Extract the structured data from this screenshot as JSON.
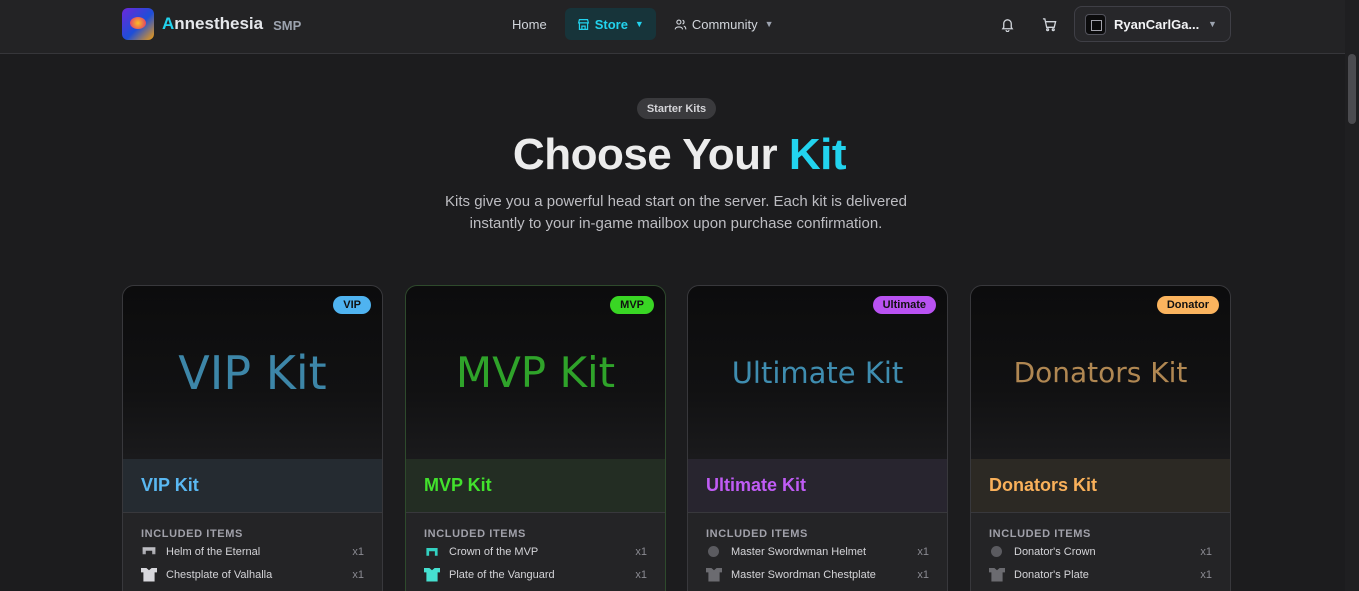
{
  "nav": {
    "brand_first": "A",
    "brand_rest": "nnesthesia",
    "brand_sub": "SMP",
    "home": "Home",
    "store": "Store",
    "community": "Community",
    "username": "RyanCarlGa..."
  },
  "hero": {
    "badge": "Starter Kits",
    "title_main": "Choose Your",
    "title_highlight": "Kit",
    "subtitle": "Kits give you a powerful head start on the server. Each kit is delivered instantly to your in-game mailbox upon purchase confirmation."
  },
  "colors": {
    "accent": "#22d3ee",
    "vip": "#4fb3f0",
    "mvp": "#39d624",
    "ultimate": "#b952f2",
    "donator": "#fbb45e"
  },
  "included_label": "INCLUDED ITEMS",
  "kits": [
    {
      "tier": "VIP",
      "image_text": "VIP Kit",
      "name": "VIP Kit",
      "items": [
        {
          "name": "Helm of the Eternal",
          "qty": "x1",
          "icon": "iron-helmet-icon"
        },
        {
          "name": "Chestplate of Valhalla",
          "qty": "x1",
          "icon": "iron-chestplate-icon"
        }
      ]
    },
    {
      "tier": "MVP",
      "image_text": "MVP Kit",
      "name": "MVP Kit",
      "items": [
        {
          "name": "Crown of the MVP",
          "qty": "x1",
          "icon": "diamond-helmet-icon"
        },
        {
          "name": "Plate of the Vanguard",
          "qty": "x1",
          "icon": "diamond-chestplate-icon"
        }
      ]
    },
    {
      "tier": "Ultimate",
      "image_text": "Ultimate Kit",
      "name": "Ultimate Kit",
      "items": [
        {
          "name": "Master Swordwman Helmet",
          "qty": "x1",
          "icon": "netherite-helmet-icon"
        },
        {
          "name": "Master Swordman Chestplate",
          "qty": "x1",
          "icon": "netherite-chestplate-icon"
        }
      ]
    },
    {
      "tier": "Donator",
      "image_text": "Donators Kit",
      "name": "Donators Kit",
      "items": [
        {
          "name": "Donator's Crown",
          "qty": "x1",
          "icon": "netherite-helmet-icon"
        },
        {
          "name": "Donator's Plate",
          "qty": "x1",
          "icon": "netherite-chestplate-icon"
        }
      ]
    }
  ]
}
